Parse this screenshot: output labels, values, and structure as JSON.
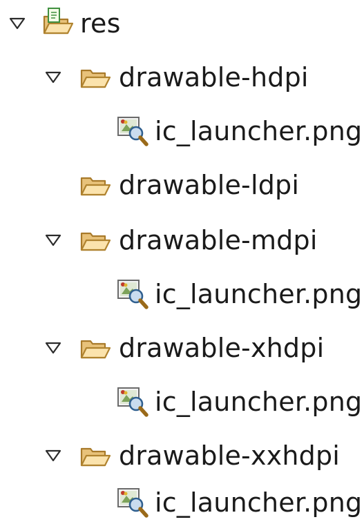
{
  "tree": {
    "root": {
      "label": "res",
      "expanded": true,
      "icon": "resource-folder-icon"
    },
    "folders": [
      {
        "label": "drawable-hdpi",
        "expanded": true,
        "icon": "folder-open-icon",
        "children": [
          {
            "label": "ic_launcher.png",
            "icon": "image-file-icon"
          }
        ]
      },
      {
        "label": "drawable-ldpi",
        "expanded": false,
        "icon": "folder-open-icon",
        "children": []
      },
      {
        "label": "drawable-mdpi",
        "expanded": true,
        "icon": "folder-open-icon",
        "children": [
          {
            "label": "ic_launcher.png",
            "icon": "image-file-icon"
          }
        ]
      },
      {
        "label": "drawable-xhdpi",
        "expanded": true,
        "icon": "folder-open-icon",
        "children": [
          {
            "label": "ic_launcher.png",
            "icon": "image-file-icon"
          }
        ]
      },
      {
        "label": "drawable-xxhdpi",
        "expanded": true,
        "icon": "folder-open-icon",
        "children": [
          {
            "label": "ic_launcher.png",
            "icon": "image-file-icon"
          }
        ]
      }
    ]
  }
}
